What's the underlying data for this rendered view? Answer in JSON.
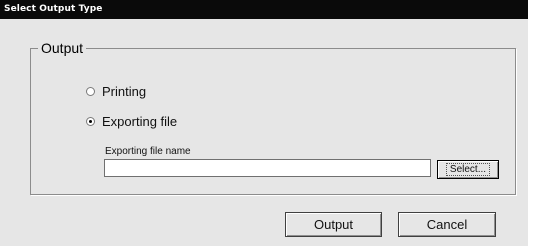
{
  "window": {
    "title": "Select Output Type"
  },
  "group": {
    "title": "Output"
  },
  "options": [
    {
      "label": "Printing",
      "selected": false
    },
    {
      "label": "Exporting file",
      "selected": true
    }
  ],
  "export": {
    "field_label": "Exporting file name",
    "value": "",
    "select_label": "Select..."
  },
  "buttons": {
    "output": "Output",
    "cancel": "Cancel"
  }
}
